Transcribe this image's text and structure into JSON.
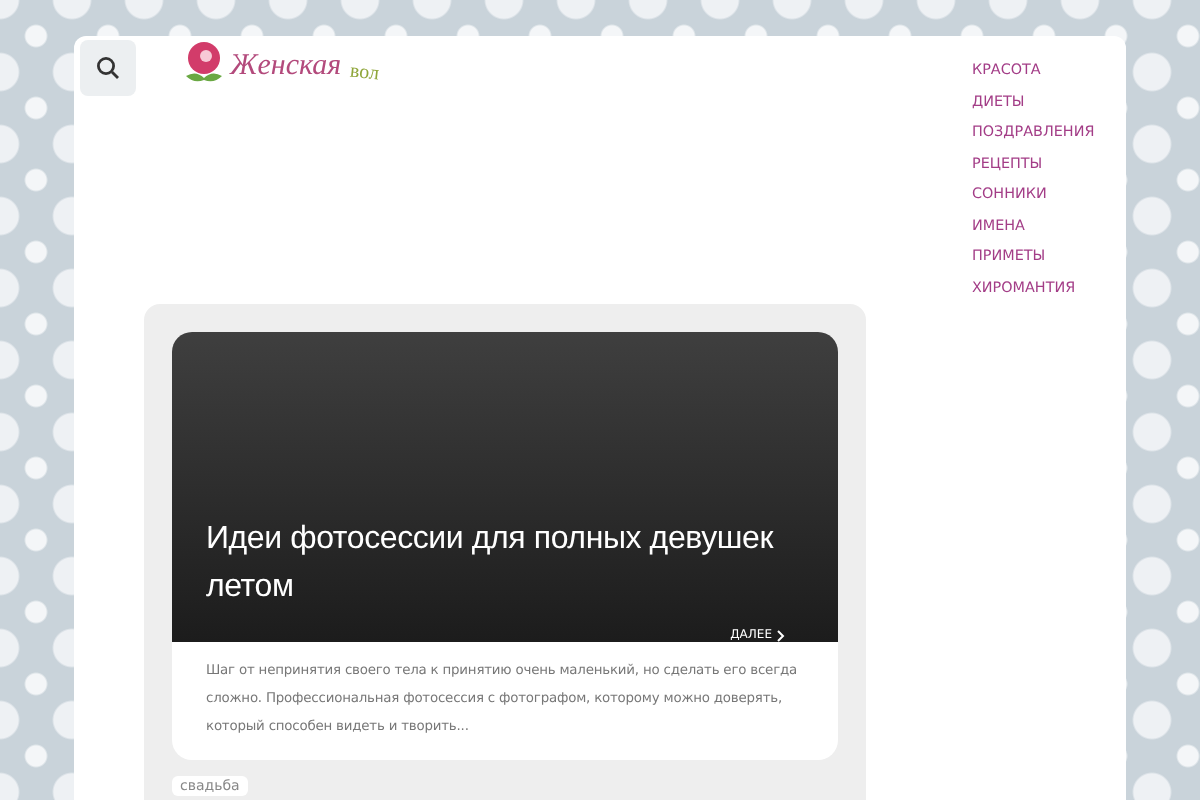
{
  "logo": {
    "text": "Женская",
    "text_2": "вол"
  },
  "nav": [
    {
      "label": "КРАСОТА"
    },
    {
      "label": "ДИЕТЫ"
    },
    {
      "label": "ПОЗДРАВЛЕНИЯ"
    },
    {
      "label": "РЕЦЕПТЫ"
    },
    {
      "label": "СОННИКИ"
    },
    {
      "label": "ИМЕНА"
    },
    {
      "label": "ПРИМЕТЫ"
    },
    {
      "label": "ХИРОМАНТИЯ"
    }
  ],
  "post": {
    "title": "Идеи фотосессии для полных девушек летом",
    "more": "ДАЛЕЕ",
    "excerpt": "Шаг от непринятия своего тела к принятию очень маленький, но сделать его всегда сложно. Профессиональная фотосессия с фотографом, которому можно доверять, который способен видеть и творить...",
    "tag": "свадьба"
  }
}
